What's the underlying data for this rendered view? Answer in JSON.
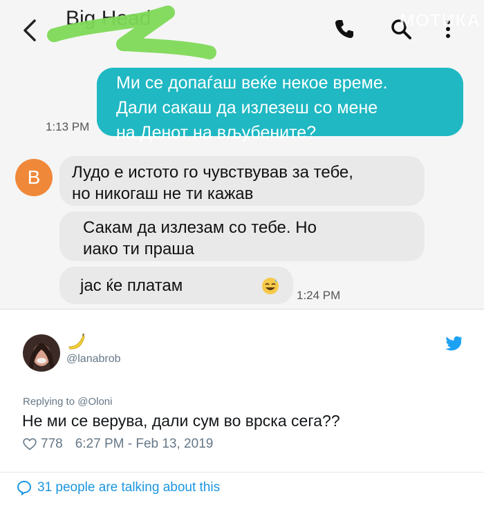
{
  "chat": {
    "contact_name": "Big Head",
    "watermark": "МОТИКА",
    "messages": [
      {
        "dir": "sent",
        "text_lines": [
          "Ми се допаѓаш веќе некое време.",
          "Дали сакаш да излезеш со мене",
          "на Денот на вљубените?"
        ],
        "time": "1:13 PM"
      },
      {
        "dir": "received",
        "text_lines": [
          "Лудо е истото го чувствував за тебе,",
          "но никогаш не ти кажав"
        ]
      },
      {
        "dir": "received",
        "text_lines": [
          "Сакам да излезам со тебе. Но",
          "иако ти праша"
        ]
      },
      {
        "dir": "received",
        "text": "јас ќе платам",
        "time": "1:24 PM"
      }
    ],
    "avatar_letter": "B",
    "colors": {
      "sent_bubble": "#1fb8c3",
      "received_bubble": "#e9e9e9",
      "avatar": "#f0883a",
      "scribble": "#7ed957"
    }
  },
  "tweet": {
    "handle": "@lanabrob",
    "replying_to": "Replying to @Oloni",
    "text": "Не ми се верува, дали сум во врска сега??",
    "likes": "778",
    "timestamp": "6:27 PM - Feb 13, 2019",
    "talking": "31 people are talking about this",
    "icons": [
      "banana-emoji",
      "twitter-bird-icon",
      "heart-icon",
      "speech-bubble-icon"
    ]
  }
}
